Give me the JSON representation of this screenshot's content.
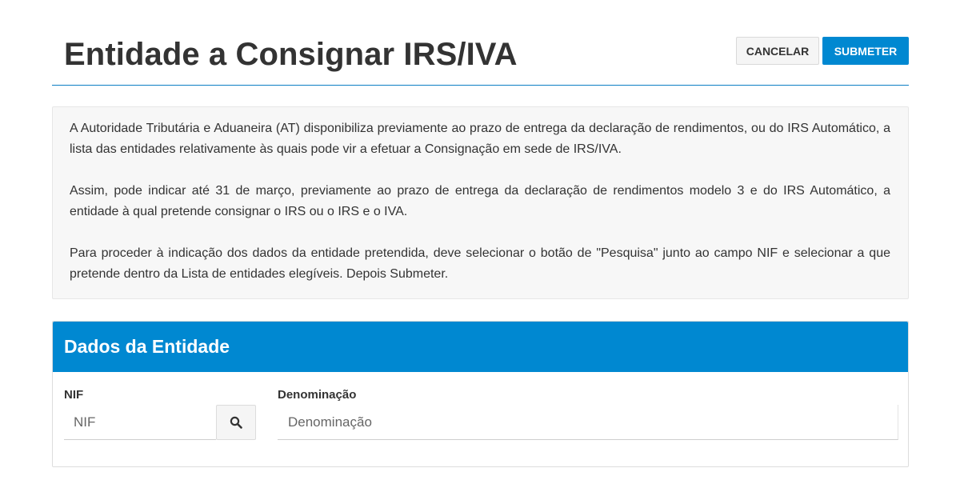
{
  "header": {
    "title": "Entidade a Consignar IRS/IVA",
    "cancel_label": "CANCELAR",
    "submit_label": "SUBMETER"
  },
  "info": {
    "paragraphs": [
      "A Autoridade Tributária e Aduaneira (AT) disponibiliza previamente ao prazo de entrega da declaração de rendimentos, ou do IRS Automático, a lista das entidades relativamente às quais pode vir a efetuar a Consignação em sede de IRS/IVA.",
      "Assim, pode indicar até 31 de março, previamente ao prazo de entrega da declaração de rendimentos modelo 3 e do IRS Automático, a entidade à qual pretende consignar o IRS ou o IRS e o IVA.",
      "Para proceder à indicação dos dados da entidade pretendida, deve selecionar o botão de \"Pesquisa\" junto ao campo NIF e selecionar a que pretende dentro da Lista de entidades elegíveis. Depois Submeter."
    ]
  },
  "panel": {
    "title": "Dados da Entidade",
    "nif": {
      "label": "NIF",
      "placeholder": "NIF",
      "value": "",
      "search_icon": "search-icon"
    },
    "denominacao": {
      "label": "Denominação",
      "placeholder": "Denominação",
      "value": ""
    }
  },
  "colors": {
    "accent": "#0088d1",
    "header_rule": "#0d7fc4",
    "info_background": "#f7f7f7"
  }
}
